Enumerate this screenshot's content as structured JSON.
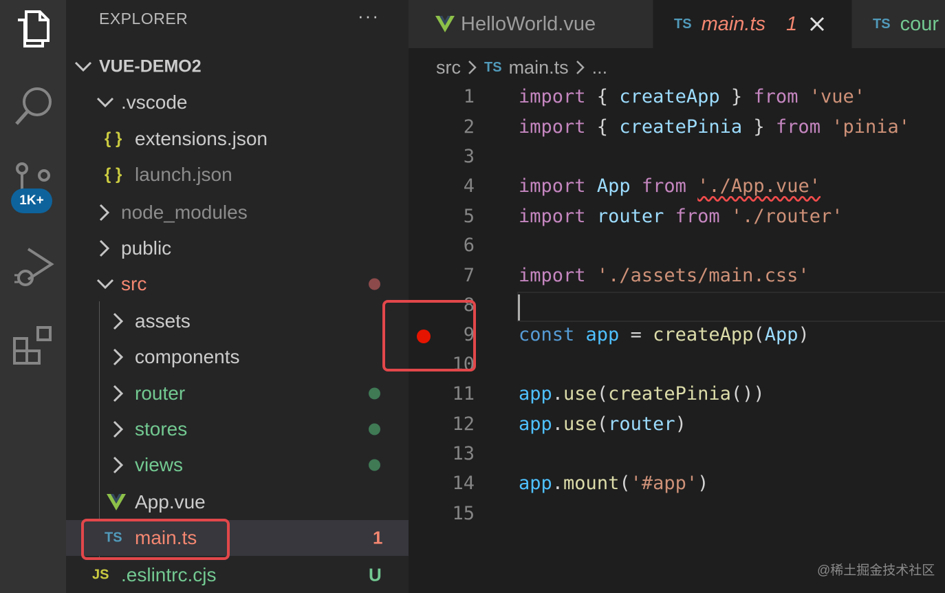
{
  "activity": {
    "icons": [
      "explorer-icon",
      "search-icon",
      "source-control-icon",
      "run-debug-icon",
      "extensions-icon"
    ],
    "scm_badge": "1K+"
  },
  "sidebar": {
    "title": "EXPLORER",
    "more": "···",
    "project": "VUE-DEMO2",
    "rows": [
      {
        "label": ".vscode"
      },
      {
        "label": "extensions.json",
        "icon": "{ }"
      },
      {
        "label": "launch.json",
        "icon": "{ }"
      },
      {
        "label": "node_modules"
      },
      {
        "label": "public"
      },
      {
        "label": "src"
      },
      {
        "label": "assets"
      },
      {
        "label": "components"
      },
      {
        "label": "router"
      },
      {
        "label": "stores"
      },
      {
        "label": "views"
      },
      {
        "label": "App.vue"
      },
      {
        "label": "main.ts",
        "icon": "TS",
        "badge": "1"
      },
      {
        "label": ".eslintrc.cjs",
        "icon": "JS",
        "badge": "U"
      }
    ]
  },
  "tabs": [
    {
      "label": "HelloWorld.vue"
    },
    {
      "label": "main.ts",
      "badge": "1",
      "icon": "TS"
    },
    {
      "label": "cour",
      "icon": "TS"
    }
  ],
  "breadcrumb": {
    "folder": "src",
    "icon": "TS",
    "file": "main.ts",
    "more": "..."
  },
  "editor": {
    "line_numbers": [
      "1",
      "2",
      "3",
      "4",
      "5",
      "6",
      "7",
      "8",
      "9",
      "10",
      "11",
      "12",
      "13",
      "14",
      "15"
    ],
    "lines": {
      "l1": {
        "k": "import",
        "a": " { ",
        "b": "createApp",
        "c": " } ",
        "d": "from",
        "e": " ",
        "f": "'vue'"
      },
      "l2": {
        "k": "import",
        "a": " { ",
        "b": "createPinia",
        "c": " } ",
        "d": "from",
        "e": " ",
        "f": "'pinia'"
      },
      "l4": {
        "k": "import",
        "a": " ",
        "b": "App",
        "c": " ",
        "d": "from",
        "e": " ",
        "f": "'./App.vue'"
      },
      "l5": {
        "k": "import",
        "a": " ",
        "b": "router",
        "c": " ",
        "d": "from",
        "e": " ",
        "f": "'./router'"
      },
      "l7": {
        "k": "import",
        "a": " ",
        "f": "'./assets/main.css'"
      },
      "l9": {
        "k": "const",
        "a": " ",
        "b": "app",
        "c": " = ",
        "d": "createApp",
        "e": "(",
        "f": "App",
        "g": ")"
      },
      "l11": {
        "a": "app",
        "b": ".",
        "c": "use",
        "d": "(",
        "e": "createPinia",
        "f": "())"
      },
      "l12": {
        "a": "app",
        "b": ".",
        "c": "use",
        "d": "(",
        "e": "router",
        "f": ")"
      },
      "l14": {
        "a": "app",
        "b": ".",
        "c": "mount",
        "d": "(",
        "e": "'#app'",
        "f": ")"
      }
    }
  },
  "colors": {
    "modified_red": "#f48771",
    "untracked_green": "#73c991",
    "highlight_box": "#e2474a",
    "breakpoint": "#e51400"
  },
  "watermark": "@稀土掘金技术社区"
}
